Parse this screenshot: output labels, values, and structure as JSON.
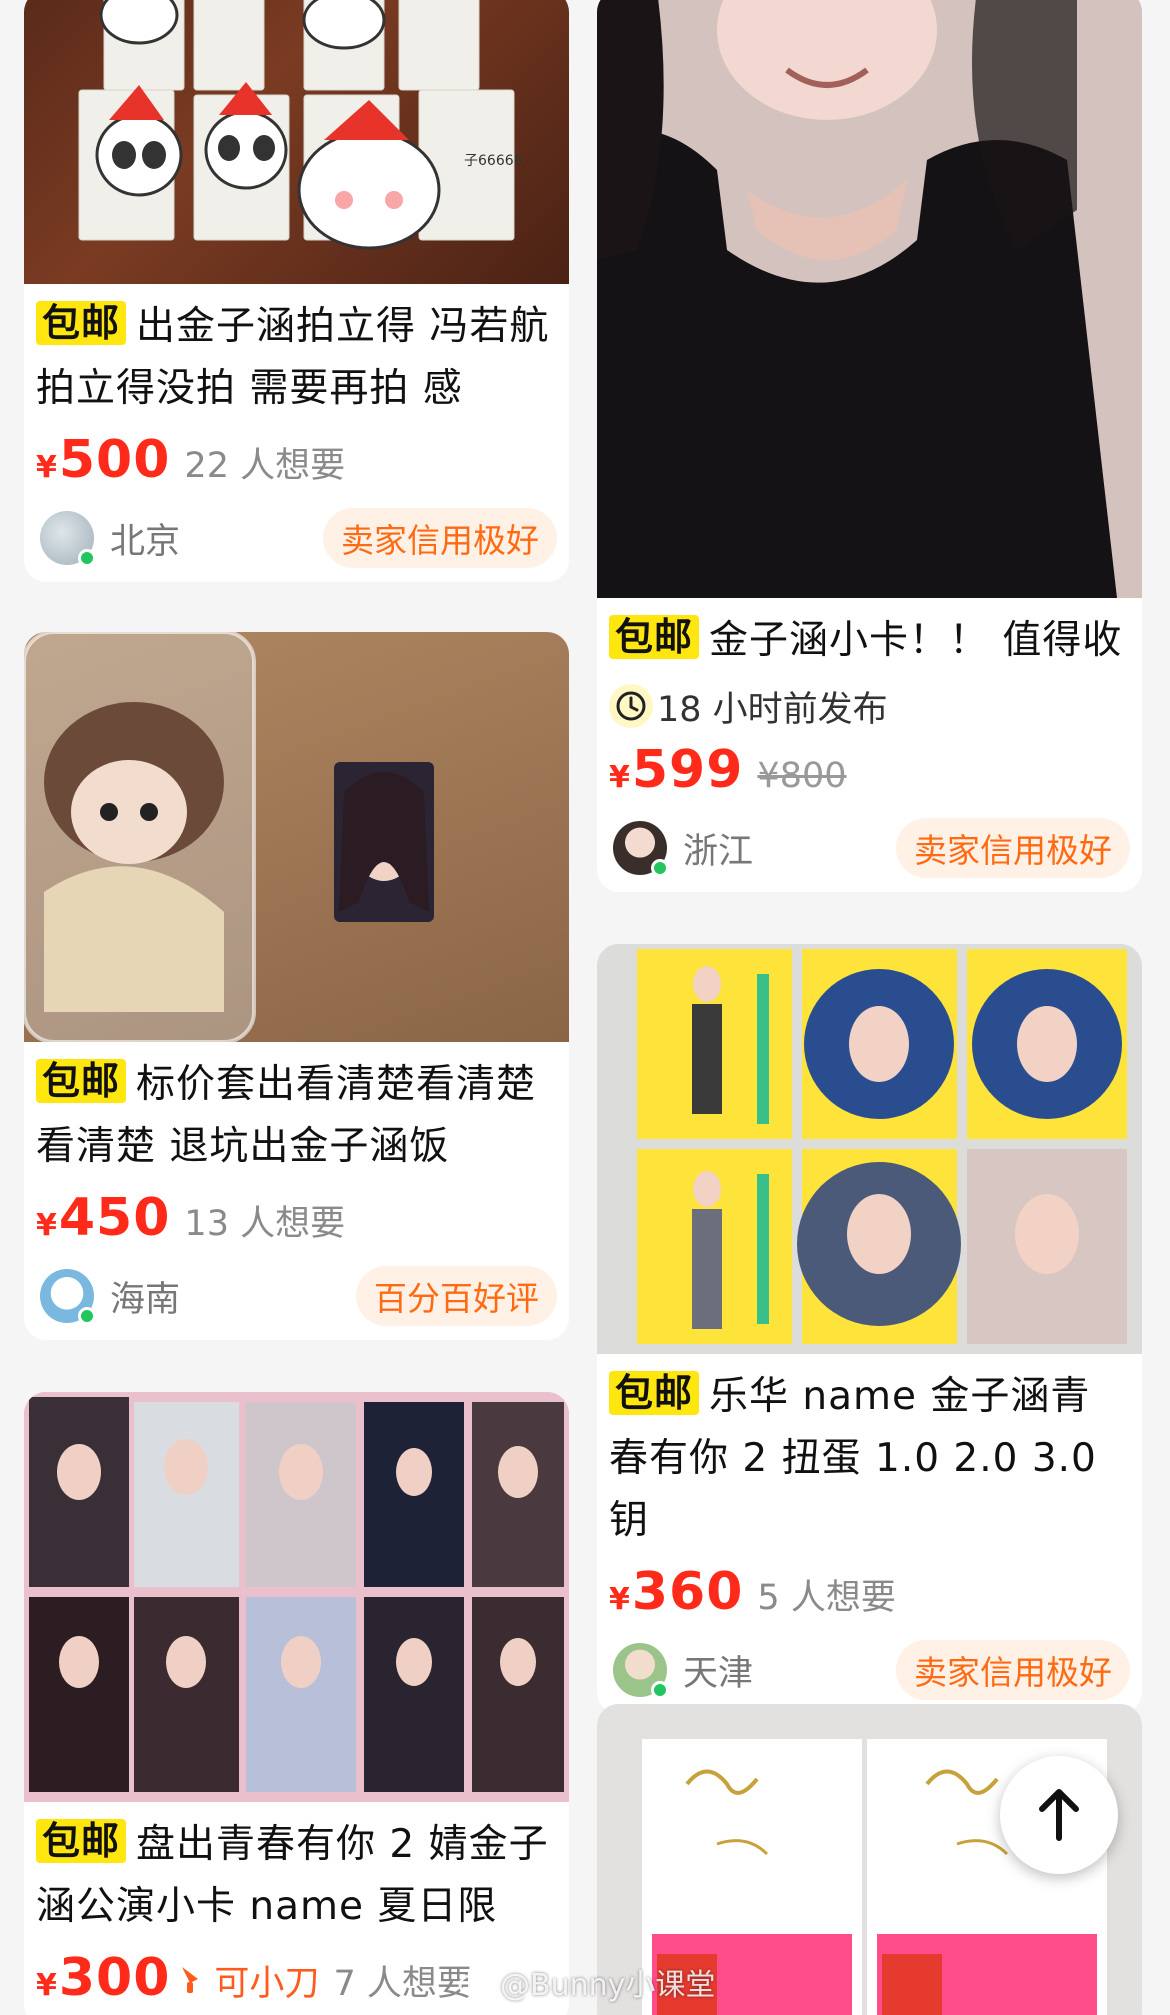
{
  "items": [
    {
      "tag": "包邮",
      "title": "出金子涵拍立得 冯若航拍立得没拍 需要再拍 感",
      "yen": "¥",
      "price": "500",
      "want": "22 人想要",
      "city": "北京",
      "badge": "卖家信用极好",
      "image_desc": "polaroids-with-cat-stickers"
    },
    {
      "tag": "包邮",
      "title": "金子涵小卡！！ 值得收",
      "time": "18 小时前发布",
      "yen": "¥",
      "price": "599",
      "orig_price": "¥800",
      "city": "浙江",
      "badge": "卖家信用极好"
    },
    {
      "tag": "包邮",
      "title": "标价套出看清楚看清楚看清楚  退坑出金子涵饭",
      "yen": "¥",
      "price": "450",
      "want": "13 人想要",
      "city": "海南",
      "badge": "百分百好评"
    },
    {
      "tag": "包邮",
      "title": "乐华 name 金子涵青春有你 2 扭蛋 1.0 2.0 3.0 钥",
      "yen": "¥",
      "price": "360",
      "want": "5 人想要",
      "city": "天津",
      "badge": "卖家信用极好"
    },
    {
      "tag": "包邮",
      "title": "盘出青春有你 2 婧金子涵公演小卡 name 夏日限",
      "yen": "¥",
      "price": "300",
      "knife": "可小刀",
      "want": "7 人想要"
    }
  ],
  "watermark": "@Bunny小课堂",
  "colors": {
    "price": "#ff2a1a",
    "tag_bg": "#ffe60f",
    "badge_text": "#ff6a13",
    "badge_bg": "#fff1e5"
  },
  "icons": {
    "back_to_top": "arrow-up-icon",
    "clock": "clock-icon",
    "knife": "knife-icon"
  }
}
